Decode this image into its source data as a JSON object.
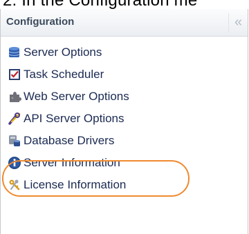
{
  "caption": {
    "text": "2. In the Configuration me"
  },
  "panel": {
    "title": "Configuration",
    "collapse_label": "«",
    "items": [
      {
        "label": "Server Options",
        "icon": "database-icon"
      },
      {
        "label": "Task Scheduler",
        "icon": "calendar-check-icon"
      },
      {
        "label": "Web Server Options",
        "icon": "puzzle-icon"
      },
      {
        "label": "API Server Options",
        "icon": "tools-icon"
      },
      {
        "label": "Database Drivers",
        "icon": "driver-icon"
      },
      {
        "label": "Server Information",
        "icon": "info-icon"
      },
      {
        "label": "License Information",
        "icon": "keys-icon"
      }
    ]
  },
  "colors": {
    "highlight": "#ef8a2e",
    "link_text": "#1b2a52",
    "header_text": "#3b4a5c"
  }
}
